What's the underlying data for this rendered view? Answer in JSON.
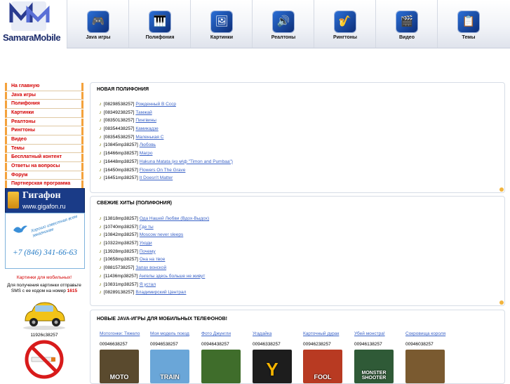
{
  "logo": {
    "text": "SamaraMobile"
  },
  "nav": [
    {
      "label": "Java игры",
      "icon": "gamepad-icon",
      "glyph": "🎮"
    },
    {
      "label": "Полифония",
      "icon": "synthesizer-icon",
      "glyph": "🎹"
    },
    {
      "label": "Картинки",
      "icon": "pictures-icon",
      "glyph": "🖼"
    },
    {
      "label": "Реалтоны",
      "icon": "speaker-icon",
      "glyph": "🔊"
    },
    {
      "label": "Рингтоны",
      "icon": "ringtone-icon",
      "glyph": "🎷"
    },
    {
      "label": "Видео",
      "icon": "film-icon",
      "glyph": "🎬"
    },
    {
      "label": "Темы",
      "icon": "themes-icon",
      "glyph": "📋"
    }
  ],
  "sidebar": {
    "items": [
      {
        "label": "На главную"
      },
      {
        "label": "Java игры"
      },
      {
        "label": "Полифония"
      },
      {
        "label": "Картинки"
      },
      {
        "label": "Реалтоны"
      },
      {
        "label": "Рингтоны"
      },
      {
        "label": "Видео"
      },
      {
        "label": "Темы"
      },
      {
        "label": "Бесплатный контент"
      },
      {
        "label": "Ответы на вопросы"
      },
      {
        "label": "Форум"
      },
      {
        "label": "Партнерская программа"
      }
    ]
  },
  "banners": {
    "gigafon_title": "Гигафон",
    "gigafon_url": "www.gigafon.ru",
    "slogan": "Хорошо известная всем заказчикам",
    "phone": "+7 (846) 341-66-63"
  },
  "promo": {
    "heading": "Картинки для мобильных!",
    "desc_prefix": "Для получения картинки отправьте SMS с ее кодом на номер",
    "number": "1615",
    "code": "11926c38257"
  },
  "polyphony": {
    "title": "НОВАЯ ПОЛИФОНИЯ",
    "items": [
      {
        "code": "[08298538257]",
        "title": "Рожденный В Ссср"
      },
      {
        "code": "[08349238257]",
        "title": "Тамжай"
      },
      {
        "code": "[08350138257]",
        "title": "Пингвины"
      },
      {
        "code": "[08354438257]",
        "title": "Камикадзе"
      },
      {
        "code": "[08354538257]",
        "title": "Маленькая С"
      },
      {
        "code": "[10845mp38257]",
        "title": "Любовь"
      },
      {
        "code": "[16466mp38257]",
        "title": "Магро"
      },
      {
        "code": "[16448mp38257]",
        "title": "Hakuna Matata (из м\\ф \"Timon and Pumbaa\")"
      },
      {
        "code": "[16450mp38257]",
        "title": "Flowers On The Grave"
      },
      {
        "code": "[16451mp38257]",
        "title": "It Doesn't Matter"
      }
    ]
  },
  "hits": {
    "title": "СВЕЖИЕ ХИТЫ (ПОЛИФОНИЯ)",
    "items": [
      {
        "code": "[13818mp38257]",
        "title": "Ода Нашей Любви (Вдох-Выдох)"
      },
      {
        "code": "[10740mp38257]",
        "title": "Где ты"
      },
      {
        "code": "[10842mp38257]",
        "title": "Moscow never sleeps"
      },
      {
        "code": "[10322mp38257]",
        "title": "Уходи"
      },
      {
        "code": "[13928mp38257]",
        "title": "Почему"
      },
      {
        "code": "[10658mp38257]",
        "title": "Она на твое"
      },
      {
        "code": "[08815738257]",
        "title": "Запах вонской"
      },
      {
        "code": "[11436mp38257]",
        "title": "Ангелы здесь больше не живут"
      },
      {
        "code": "[10831mp38257]",
        "title": "Я устал"
      },
      {
        "code": "[08289138257]",
        "title": "Владимирский Централ"
      }
    ]
  },
  "games": {
    "title": "НОВЫЕ JAVA-ИГРЫ ДЛЯ МОБИЛЬНЫХ ТЕЛЕФОНОВ!",
    "items": [
      {
        "title": "Мотогонки: Тяжело",
        "code": "00946638257",
        "cap": "MOTO",
        "bg": "#5a4a2e"
      },
      {
        "title": "Моя модель поезд",
        "code": "00946538257",
        "cap": "TRAIN",
        "bg": "#6aa6d8"
      },
      {
        "title": "Фото Джунгли",
        "code": "00946438257",
        "cap": "",
        "bg": "#3f6d2b"
      },
      {
        "title": "Угадайка",
        "code": "00946338257",
        "cap": "Y",
        "bg": "#1d1d1d"
      },
      {
        "title": "Карточный дурак",
        "code": "00946238257",
        "cap": "FOOL",
        "bg": "#b83a22"
      },
      {
        "title": "Убей монстра!",
        "code": "00946138257",
        "cap": "MONSTER SHOOTER",
        "bg": "#2f5a37"
      },
      {
        "title": "Сокровища короля",
        "code": "00946038257",
        "cap": "",
        "bg": "#7a5a30"
      }
    ]
  }
}
